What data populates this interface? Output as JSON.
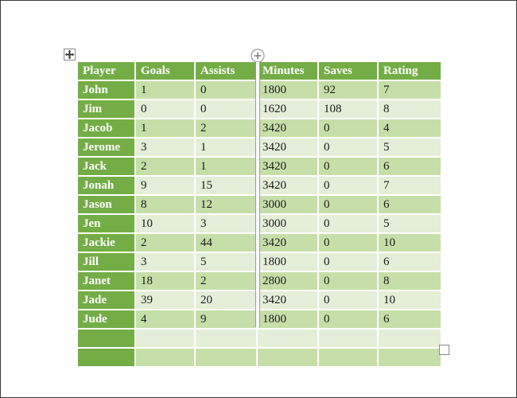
{
  "document": {
    "move_handle_icon": "move-cross-icon",
    "column_insert_icon": "circled-plus-icon",
    "resize_handle_icon": "resize-square-icon"
  },
  "colors": {
    "header_green": "#74ad46",
    "band_medium": "#c6dfa9",
    "band_light": "#e4eed8",
    "header_text": "#ffffff",
    "body_text": "#1b1b1b",
    "page_border": "#3b3b3b",
    "handle_border": "#8a8a8a",
    "marker_gray": "#9a9a9a"
  },
  "table": {
    "columns": [
      "Player",
      "Goals",
      "Assists",
      "Minutes",
      "Saves",
      "Rating"
    ],
    "rows": [
      {
        "player": "John",
        "goals": "1",
        "assists": "0",
        "minutes": "1800",
        "saves": "92",
        "rating": "7"
      },
      {
        "player": "Jim",
        "goals": "0",
        "assists": "0",
        "minutes": "1620",
        "saves": "108",
        "rating": "8"
      },
      {
        "player": "Jacob",
        "goals": "1",
        "assists": "2",
        "minutes": "3420",
        "saves": "0",
        "rating": "4"
      },
      {
        "player": "Jerome",
        "goals": "3",
        "assists": "1",
        "minutes": "3420",
        "saves": "0",
        "rating": "5"
      },
      {
        "player": "Jack",
        "goals": "2",
        "assists": "1",
        "minutes": "3420",
        "saves": "0",
        "rating": "6"
      },
      {
        "player": "Jonah",
        "goals": "9",
        "assists": "15",
        "minutes": "3420",
        "saves": "0",
        "rating": "7"
      },
      {
        "player": "Jason",
        "goals": "8",
        "assists": "12",
        "minutes": "3000",
        "saves": "0",
        "rating": "6"
      },
      {
        "player": "Jen",
        "goals": "10",
        "assists": "3",
        "minutes": "3000",
        "saves": "0",
        "rating": "5"
      },
      {
        "player": "Jackie",
        "goals": "2",
        "assists": "44",
        "minutes": "3420",
        "saves": "0",
        "rating": "10"
      },
      {
        "player": "Jill",
        "goals": "3",
        "assists": "5",
        "minutes": "1800",
        "saves": "0",
        "rating": "6"
      },
      {
        "player": "Janet",
        "goals": "18",
        "assists": "2",
        "minutes": "2800",
        "saves": "0",
        "rating": "8"
      },
      {
        "player": "Jade",
        "goals": "39",
        "assists": "20",
        "minutes": "3420",
        "saves": "0",
        "rating": "10"
      },
      {
        "player": "Jude",
        "goals": "4",
        "assists": "9",
        "minutes": "1800",
        "saves": "0",
        "rating": "6"
      },
      {
        "player": "",
        "goals": "",
        "assists": "",
        "minutes": "",
        "saves": "",
        "rating": ""
      },
      {
        "player": "",
        "goals": "",
        "assists": "",
        "minutes": "",
        "saves": "",
        "rating": ""
      }
    ]
  }
}
